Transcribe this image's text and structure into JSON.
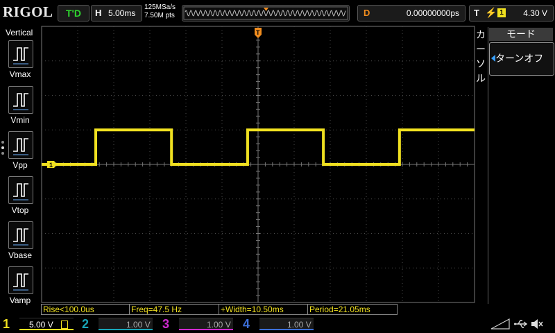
{
  "top": {
    "brand": "RIGOL",
    "run_status": "T'D",
    "horizontal": {
      "key": "H",
      "value": "5.00ms"
    },
    "sample_rate": "125MSa/s",
    "memory_depth": "7.50M pts",
    "delay": {
      "key": "D",
      "value": "0.00000000ps"
    },
    "trigger": {
      "key": "T",
      "edge_icon": "rising-edge-icon",
      "source": "1",
      "level": "4.30 V"
    }
  },
  "left_menu": {
    "title": "Vertical",
    "items": [
      {
        "label": "Vmax",
        "icon": "vmax-icon"
      },
      {
        "label": "Vmin",
        "icon": "vmin-icon"
      },
      {
        "label": "Vpp",
        "icon": "vpp-icon"
      },
      {
        "label": "Vtop",
        "icon": "vtop-icon"
      },
      {
        "label": "Vbase",
        "icon": "vbase-icon"
      },
      {
        "label": "Vamp",
        "icon": "vamp-icon"
      }
    ]
  },
  "right_menu": {
    "side_label": [
      "カ",
      "ー",
      "ソ",
      "ル"
    ],
    "mode_header": "モード",
    "mode_value": "ターンオフ"
  },
  "markers": {
    "ch1": "1",
    "trigger": "T"
  },
  "measurements": {
    "rise": "Rise<100.0us",
    "freq": "Freq=47.5 Hz",
    "width": "+Width=10.50ms",
    "period": "Period=21.05ms"
  },
  "channels": [
    {
      "num": "1",
      "scale": "5.00 V",
      "color": "#f0e020"
    },
    {
      "num": "2",
      "scale": "1.00 V",
      "color": "#18a6b8"
    },
    {
      "num": "3",
      "scale": "1.00 V",
      "color": "#d02ad0"
    },
    {
      "num": "4",
      "scale": "1.00 V",
      "color": "#3c6fd8"
    }
  ],
  "waveform": {
    "color": "#f0e020",
    "high_level_div": 1.0,
    "low_level_div": 0.0,
    "first_rise_div": 1.5,
    "width_div": 2.1,
    "period_div": 4.21
  }
}
